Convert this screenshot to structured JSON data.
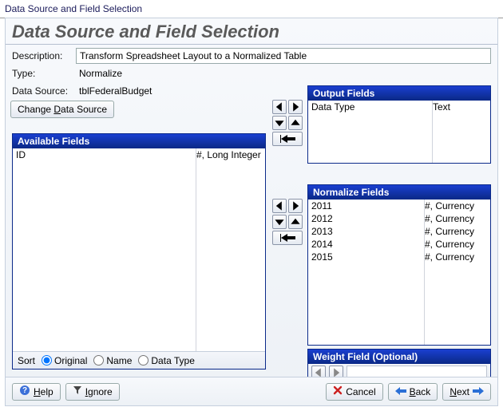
{
  "window_title": "Data Source and Field Selection",
  "heading": "Data Source and Field Selection",
  "labels": {
    "description": "Description:",
    "type": "Type:",
    "data_source": "Data Source:",
    "change_source": "Change Data Source",
    "available": "Available Fields",
    "output": "Output Fields",
    "normalize": "Normalize Fields",
    "weight": "Weight Field (Optional)",
    "sort": "Sort",
    "original": "Original",
    "name": "Name",
    "data_type": "Data Type",
    "help": "Help",
    "ignore": "Ignore",
    "cancel": "Cancel",
    "back": "Back",
    "next": "Next"
  },
  "values": {
    "description": "Transform Spreadsheet Layout to a Normalized Table",
    "type": "Normalize",
    "data_source": "tblFederalBudget"
  },
  "available_fields": [
    {
      "name": "ID",
      "type": "#, Long Integer"
    }
  ],
  "output_fields": [
    {
      "name": "Data Type",
      "type": "Text"
    }
  ],
  "normalize_fields": [
    {
      "name": "2011",
      "type": "#, Currency"
    },
    {
      "name": "2012",
      "type": "#, Currency"
    },
    {
      "name": "2013",
      "type": "#, Currency"
    },
    {
      "name": "2014",
      "type": "#, Currency"
    },
    {
      "name": "2015",
      "type": "#, Currency"
    }
  ],
  "sort_selected": "Original"
}
